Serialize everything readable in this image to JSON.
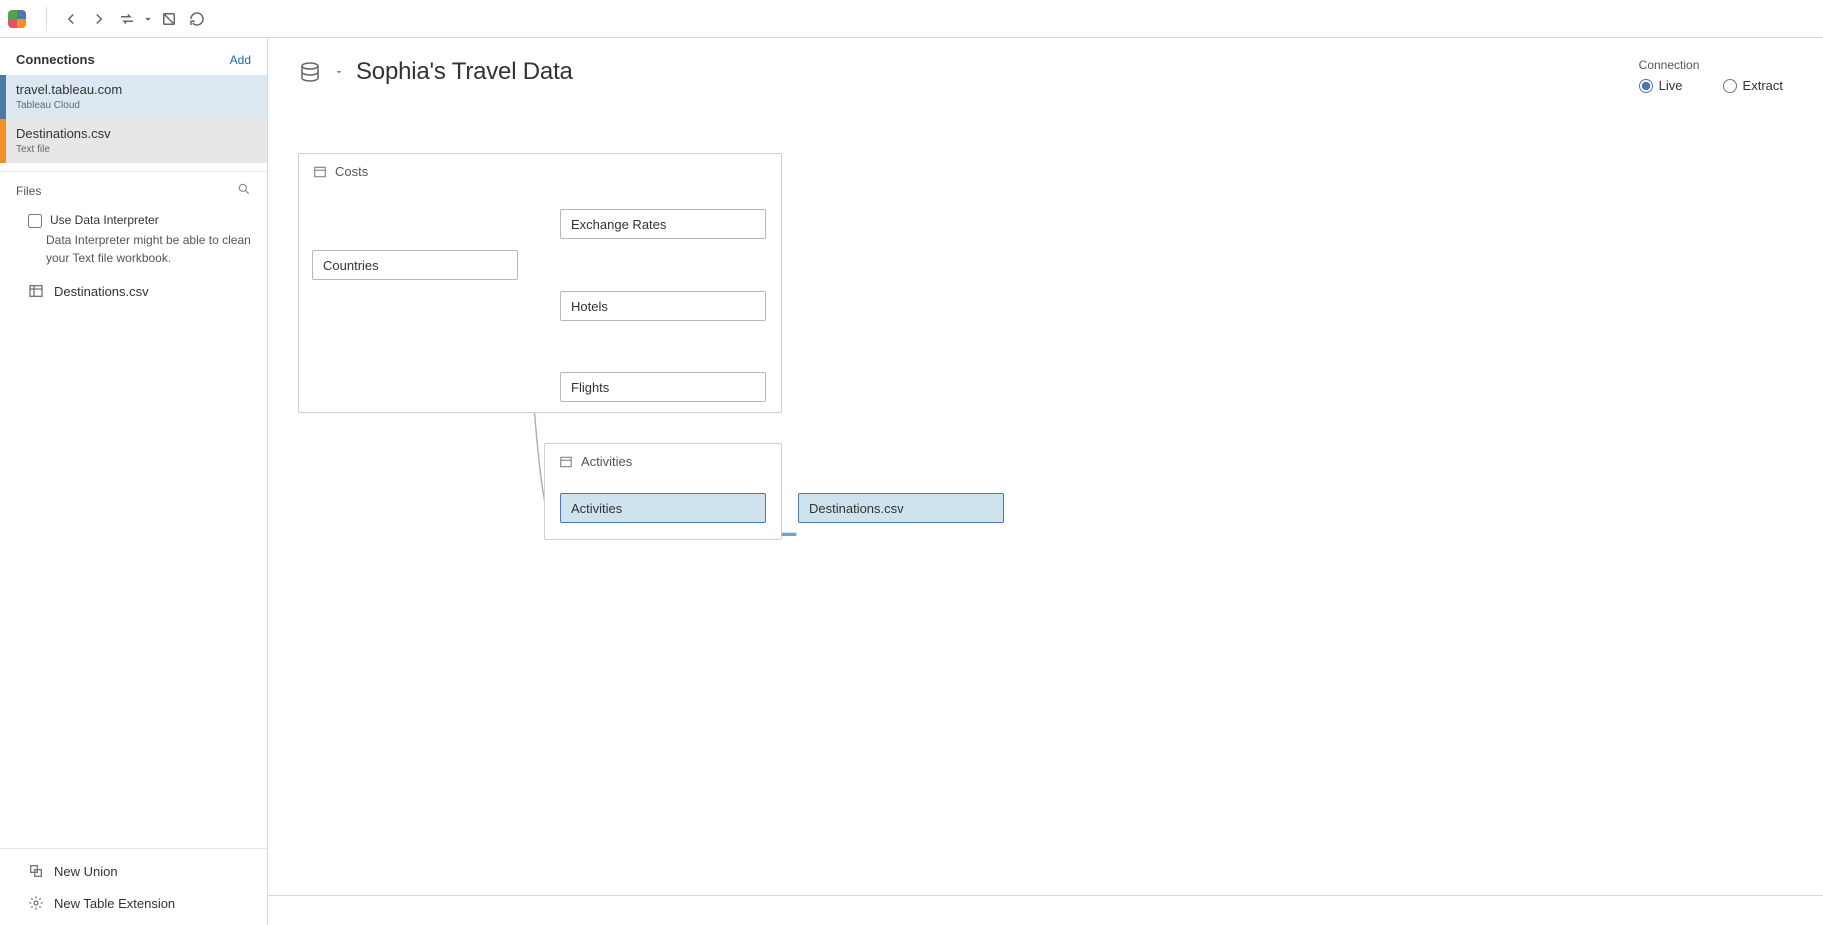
{
  "toolbar": {
    "back_icon": "back-arrow-icon",
    "forward_icon": "forward-arrow-icon",
    "swap_icon": "swap-icon",
    "refresh_icon": "refresh-icon",
    "autoupdate_icon": "autoupdate-icon"
  },
  "datasource": {
    "title": "Sophia's Travel Data"
  },
  "connection_mode": {
    "label": "Connection",
    "options": {
      "live": "Live",
      "extract": "Extract"
    },
    "selected": "live"
  },
  "sidebar": {
    "connections": {
      "title": "Connections",
      "add_label": "Add",
      "items": [
        {
          "name": "travel.tableau.com",
          "subtitle": "Tableau Cloud",
          "accent": "blue"
        },
        {
          "name": "Destinations.csv",
          "subtitle": "Text file",
          "accent": "orange"
        }
      ]
    },
    "files": {
      "title": "Files",
      "search_placeholder": "Search"
    },
    "interpreter": {
      "checkbox_label": "Use Data Interpreter",
      "description": "Data Interpreter might be able to clean your Text file workbook."
    },
    "file_list": [
      {
        "name": "Destinations.csv"
      }
    ],
    "bottom_actions": {
      "new_union": "New Union",
      "new_table_ext": "New Table Extension"
    }
  },
  "canvas": {
    "groups": {
      "costs": {
        "label": "Costs"
      },
      "activities": {
        "label": "Activities"
      }
    },
    "tables": {
      "countries": {
        "label": "Countries"
      },
      "exchange_rates": {
        "label": "Exchange Rates"
      },
      "hotels": {
        "label": "Hotels"
      },
      "flights": {
        "label": "Flights"
      },
      "activities": {
        "label": "Activities"
      },
      "destinations": {
        "label": "Destinations.csv"
      }
    }
  }
}
